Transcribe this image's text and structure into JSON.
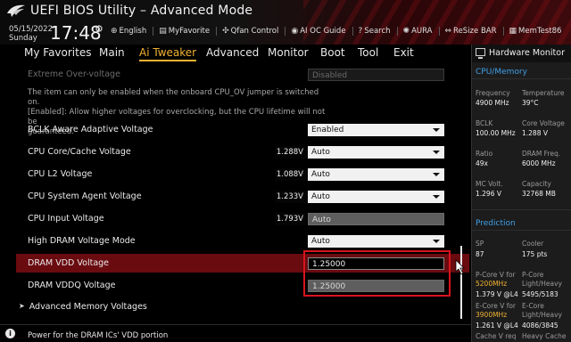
{
  "header": {
    "title": "UEFI BIOS Utility – Advanced Mode",
    "date": "05/15/2022",
    "day": "Sunday",
    "time": "17:48",
    "toolbar": [
      {
        "icon": "globe-icon",
        "label": "English"
      },
      {
        "icon": "favorite-icon",
        "label": "MyFavorite"
      },
      {
        "icon": "fan-icon",
        "label": "Qfan Control"
      },
      {
        "icon": "ai-oc-icon",
        "label": "AI OC Guide"
      },
      {
        "icon": "help-icon",
        "label": "Search"
      },
      {
        "icon": "aura-icon",
        "label": "AURA"
      },
      {
        "icon": "resize-icon",
        "label": "ReSize BAR"
      },
      {
        "icon": "memtest-icon",
        "label": "MemTest86"
      }
    ]
  },
  "menu": {
    "tabs": [
      "My Favorites",
      "Main",
      "Ai Tweaker",
      "Advanced",
      "Monitor",
      "Boot",
      "Tool",
      "Exit"
    ],
    "active": "Ai Tweaker"
  },
  "settings": {
    "extreme_overvoltage": {
      "label": "Extreme Over-voltage",
      "value": "Disabled"
    },
    "description": [
      "The item can only be enabled when the onboard CPU_OV jumper is switched on.",
      "[Enabled]: Allow higher voltages for overclocking, but the CPU lifetime will not be",
      "guaranteed."
    ],
    "bclk_aware": {
      "label": "BCLK Aware Adaptive Voltage",
      "value": "Enabled"
    },
    "cpu_core_cache": {
      "label": "CPU Core/Cache Voltage",
      "reading": "1.288V",
      "value": "Auto"
    },
    "cpu_l2": {
      "label": "CPU L2 Voltage",
      "reading": "1.088V",
      "value": "Auto"
    },
    "cpu_sa": {
      "label": "CPU System Agent Voltage",
      "reading": "1.233V",
      "value": "Auto"
    },
    "cpu_input": {
      "label": "CPU Input Voltage",
      "reading": "1.793V",
      "value": "Auto"
    },
    "high_dram_mode": {
      "label": "High DRAM Voltage Mode",
      "value": "Auto"
    },
    "dram_vdd": {
      "label": "DRAM VDD Voltage",
      "value": "1.25000"
    },
    "dram_vddq": {
      "label": "DRAM VDDQ Voltage",
      "value": "1.25000"
    },
    "advanced_memory": {
      "label": "Advanced Memory Voltages"
    }
  },
  "footer": {
    "info": "Power for the DRAM ICs' VDD portion"
  },
  "hardware_monitor": {
    "title": "Hardware Monitor",
    "cpu_memory_title": "CPU/Memory",
    "frequency": {
      "label": "Frequency",
      "value": "4900 MHz"
    },
    "temperature": {
      "label": "Temperature",
      "value": "39°C"
    },
    "bclk": {
      "label": "BCLK",
      "value": "100.00 MHz"
    },
    "core_voltage": {
      "label": "Core Voltage",
      "value": "1.288 V"
    },
    "ratio": {
      "label": "Ratio",
      "value": "49x"
    },
    "dram_freq": {
      "label": "DRAM Freq.",
      "value": "6000 MHz"
    },
    "mc_volt": {
      "label": "MC Volt.",
      "value": "1.296 V"
    },
    "capacity": {
      "label": "Capacity",
      "value": "32768 MB"
    },
    "prediction_title": "Prediction",
    "sp": {
      "label": "SP",
      "value": "87"
    },
    "cooler": {
      "label": "Cooler",
      "value": "175 pts"
    },
    "pcore_v_for": {
      "label": "P-Core V for",
      "freq": "5200MHz",
      "value": "1.379 V @L4"
    },
    "pcore_lh": {
      "label1": "P-Core",
      "label2": "Light/Heavy",
      "value": "5495/5183"
    },
    "ecore_v_for": {
      "label": "E-Core V for",
      "freq": "3900MHz",
      "value": "1.261 V @L4"
    },
    "ecore_lh": {
      "label1": "E-Core",
      "label2": "Light/Heavy",
      "value": "4086/3845"
    },
    "cache_v_req": {
      "label": "Cache V req"
    },
    "heavy_cache": {
      "label": "Heavy Cache"
    }
  }
}
